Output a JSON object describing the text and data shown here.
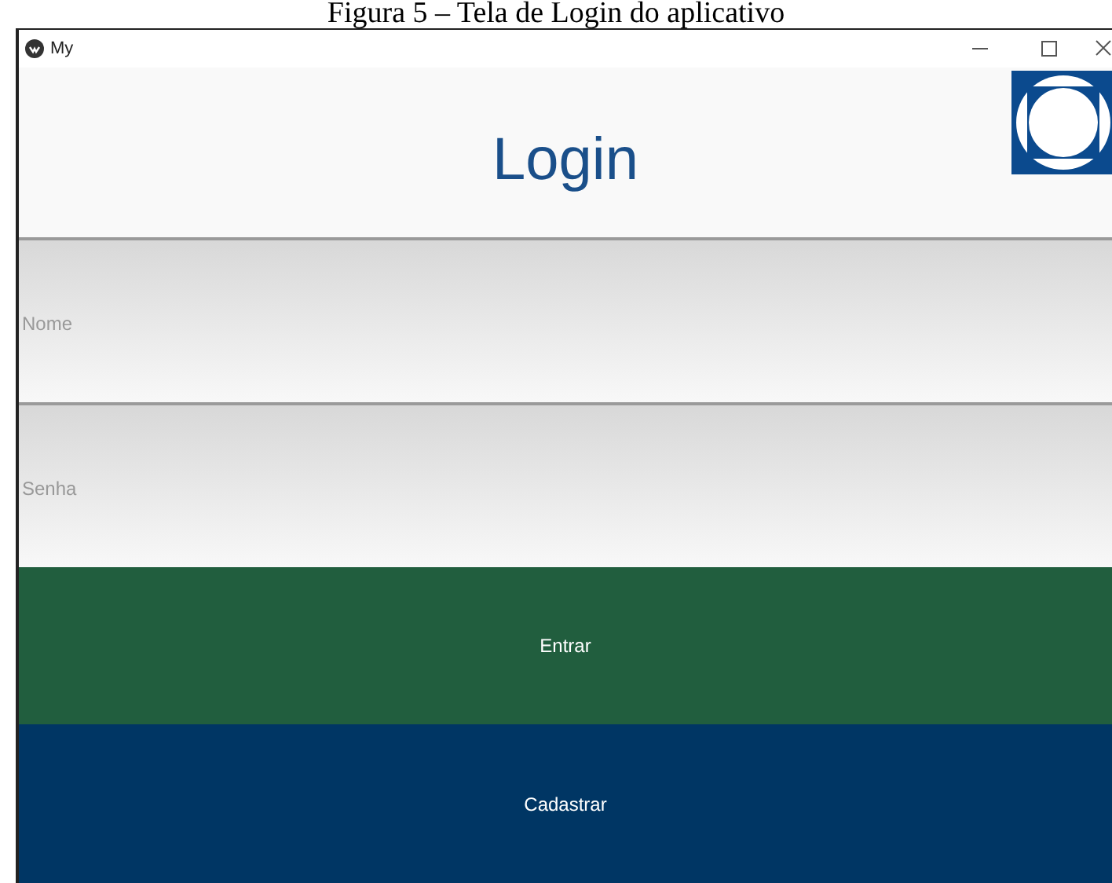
{
  "caption": "Figura 5 – Tela de Login do aplicativo",
  "window": {
    "title": "My"
  },
  "header": {
    "title": "Login"
  },
  "fields": [
    {
      "placeholder": "Nome"
    },
    {
      "placeholder": "Senha"
    }
  ],
  "buttons": [
    {
      "label": "Entrar",
      "color": "#215e3e"
    },
    {
      "label": "Cadastrar",
      "color": "#003664"
    }
  ]
}
